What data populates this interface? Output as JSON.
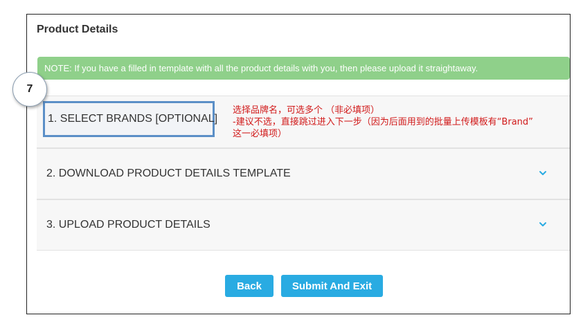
{
  "page": {
    "title": "Product Details"
  },
  "note": {
    "text": "NOTE: If you have a filled in template with all the product details with you, then please upload it straightaway.",
    "color": "#8fd08a"
  },
  "step_badge": {
    "number": "7"
  },
  "sections": [
    {
      "label": "1. SELECT BRANDS [OPTIONAL]",
      "icon": "none"
    },
    {
      "label": "2. DOWNLOAD PRODUCT DETAILS TEMPLATE",
      "icon": "chevron-down-icon"
    },
    {
      "label": "3. UPLOAD PRODUCT DETAILS",
      "icon": "chevron-down-icon"
    }
  ],
  "annotation": {
    "lines": [
      "选择品牌名，可选多个 （非必填项）",
      "-建议不选，直接跳过进入下一步（因为后面用到的批量上传模板有“Brand”",
      "这一必填项）"
    ],
    "color": "#d11a1a"
  },
  "buttons": {
    "back_label": "Back",
    "submit_label": "Submit And Exit",
    "accent": "#29abe2"
  }
}
